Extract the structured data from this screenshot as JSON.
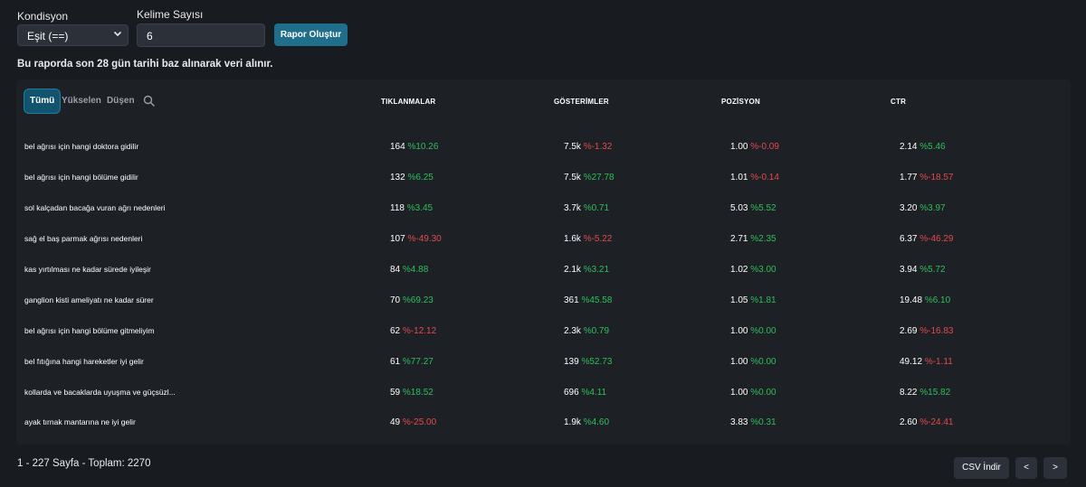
{
  "controls": {
    "condition_label": "Kondisyon",
    "condition_value": "Eşit (==)",
    "word_count_label": "Kelime Sayısı",
    "word_count_value": "6",
    "report_button": "Rapor Oluştur"
  },
  "info_text": "Bu raporda son 28 gün tarihi baz alınarak veri alınır.",
  "tabs": [
    "Tümü",
    "Yükselen",
    "Düşen"
  ],
  "columns": [
    "TIKLANMALAR",
    "GÖSTERİMLER",
    "POZİSYON",
    "CTR"
  ],
  "rows": [
    {
      "keyword": "bel ağrısı için hangi doktora gidilir",
      "clicks": "164",
      "clicks_d": "%10.26",
      "clicks_s": "pos",
      "impr": "7.5k",
      "impr_d": "%-1.32",
      "impr_s": "neg",
      "pos": "1.00",
      "pos_d": "%-0.09",
      "pos_s": "neg",
      "ctr": "2.14",
      "ctr_d": "%5.46",
      "ctr_s": "pos"
    },
    {
      "keyword": "bel ağrısı için hangi bölüme gidilir",
      "clicks": "132",
      "clicks_d": "%6.25",
      "clicks_s": "pos",
      "impr": "7.5k",
      "impr_d": "%27.78",
      "impr_s": "pos",
      "pos": "1.01",
      "pos_d": "%-0.14",
      "pos_s": "neg",
      "ctr": "1.77",
      "ctr_d": "%-18.57",
      "ctr_s": "neg"
    },
    {
      "keyword": "sol kalçadan bacağa vuran ağrı nedenleri",
      "clicks": "118",
      "clicks_d": "%3.45",
      "clicks_s": "pos",
      "impr": "3.7k",
      "impr_d": "%0.71",
      "impr_s": "pos",
      "pos": "5.03",
      "pos_d": "%5.52",
      "pos_s": "pos",
      "ctr": "3.20",
      "ctr_d": "%3.97",
      "ctr_s": "pos"
    },
    {
      "keyword": "sağ el baş parmak ağrısı nedenleri",
      "clicks": "107",
      "clicks_d": "%-49.30",
      "clicks_s": "neg",
      "impr": "1.6k",
      "impr_d": "%-5.22",
      "impr_s": "neg",
      "pos": "2.71",
      "pos_d": "%2.35",
      "pos_s": "pos",
      "ctr": "6.37",
      "ctr_d": "%-46.29",
      "ctr_s": "neg"
    },
    {
      "keyword": "kas yırtılması ne kadar sürede iyileşir",
      "clicks": "84",
      "clicks_d": "%4.88",
      "clicks_s": "pos",
      "impr": "2.1k",
      "impr_d": "%3.21",
      "impr_s": "pos",
      "pos": "1.02",
      "pos_d": "%3.00",
      "pos_s": "pos",
      "ctr": "3.94",
      "ctr_d": "%5.72",
      "ctr_s": "pos"
    },
    {
      "keyword": "ganglion kisti ameliyatı ne kadar sürer",
      "clicks": "70",
      "clicks_d": "%69.23",
      "clicks_s": "pos",
      "impr": "361",
      "impr_d": "%45.58",
      "impr_s": "pos",
      "pos": "1.05",
      "pos_d": "%1.81",
      "pos_s": "pos",
      "ctr": "19.48",
      "ctr_d": "%6.10",
      "ctr_s": "pos"
    },
    {
      "keyword": "bel ağrısı için hangi bölüme gitmeliyim",
      "clicks": "62",
      "clicks_d": "%-12.12",
      "clicks_s": "neg",
      "impr": "2.3k",
      "impr_d": "%0.79",
      "impr_s": "pos",
      "pos": "1.00",
      "pos_d": "%0.00",
      "pos_s": "pos",
      "ctr": "2.69",
      "ctr_d": "%-16.83",
      "ctr_s": "neg"
    },
    {
      "keyword": "bel fıtığına hangi hareketler iyi gelir",
      "clicks": "61",
      "clicks_d": "%77.27",
      "clicks_s": "pos",
      "impr": "139",
      "impr_d": "%52.73",
      "impr_s": "pos",
      "pos": "1.00",
      "pos_d": "%0.00",
      "pos_s": "pos",
      "ctr": "49.12",
      "ctr_d": "%-1.11",
      "ctr_s": "neg"
    },
    {
      "keyword": "kollarda ve bacaklarda uyuşma ve güçsüzl...",
      "clicks": "59",
      "clicks_d": "%18.52",
      "clicks_s": "pos",
      "impr": "696",
      "impr_d": "%4.11",
      "impr_s": "pos",
      "pos": "1.00",
      "pos_d": "%0.00",
      "pos_s": "pos",
      "ctr": "8.22",
      "ctr_d": "%15.82",
      "ctr_s": "pos"
    },
    {
      "keyword": "ayak tırnak mantarına ne iyi gelir",
      "clicks": "49",
      "clicks_d": "%-25.00",
      "clicks_s": "neg",
      "impr": "1.9k",
      "impr_d": "%4.60",
      "impr_s": "pos",
      "pos": "3.83",
      "pos_d": "%0.31",
      "pos_s": "pos",
      "ctr": "2.60",
      "ctr_d": "%-24.41",
      "ctr_s": "neg"
    }
  ],
  "footer": {
    "pagination_text": "1 - 227 Sayfa - Toplam: 2270",
    "csv_button": "CSV İndir",
    "prev": "<",
    "next": ">"
  },
  "colors": {
    "positive": "#2fbe5b",
    "negative": "#e5484d",
    "accent": "#1e6e8c"
  }
}
